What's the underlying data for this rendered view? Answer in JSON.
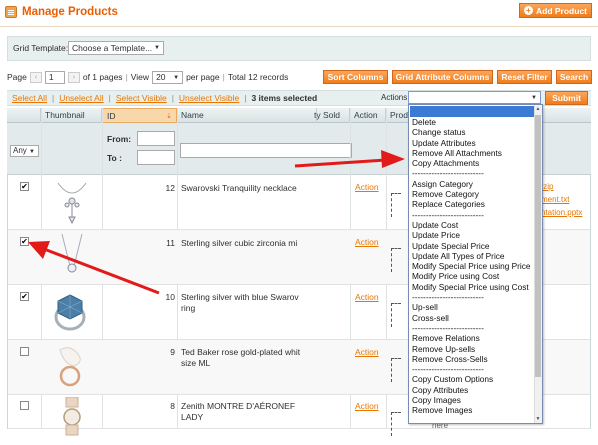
{
  "header": {
    "title": "Manage Products",
    "add_product_label": "Add Product"
  },
  "grid_template": {
    "label": "Grid Template:",
    "selected": "Choose a Template..."
  },
  "pager": {
    "page_label": "Page",
    "page_value": "1",
    "of_pages": "of 1 pages",
    "view_label": "View",
    "per_page_value": "20",
    "per_page_label": "per page",
    "total": "Total 12 records"
  },
  "buttons": {
    "sort_columns": "Sort Columns",
    "grid_attribute_columns": "Grid Attribute Columns",
    "reset_filter": "Reset Filter",
    "search": "Search",
    "submit": "Submit"
  },
  "massaction": {
    "select_all": "Select All",
    "unselect_all": "Unselect All",
    "select_visible": "Select Visible",
    "unselect_visible": "Unselect Visible",
    "selected_count": "3 items selected",
    "actions_label": "Actions"
  },
  "columns": {
    "thumbnail": "Thumbnail",
    "id": "ID",
    "name": "Name",
    "qty_sold": "ty Sold",
    "action": "Action",
    "prod": "Prod"
  },
  "filters": {
    "any": "Any",
    "from": "From:",
    "to": "To :"
  },
  "rows": [
    {
      "checked": true,
      "id": "12",
      "name_lines": [
        "Swarovski Tranquility necklace"
      ],
      "action": "Action"
    },
    {
      "checked": true,
      "id": "11",
      "name_lines": [
        "Sterling silver cubic zirconia mi"
      ],
      "action": "Action"
    },
    {
      "checked": true,
      "id": "10",
      "name_lines": [
        "Sterling silver with blue Swarov",
        "ring"
      ],
      "action": "Action"
    },
    {
      "checked": false,
      "id": "9",
      "name_lines": [
        "Ted Baker rose gold-plated whit",
        "size ML"
      ],
      "action": "Action"
    },
    {
      "checked": false,
      "id": "8",
      "name_lines": [
        "Zenith MONTRE D'AÉRONEF",
        "LADY"
      ],
      "action": "Action"
    }
  ],
  "attachment_links": [
    ".zip",
    "ment.txt",
    "ntation.pptx"
  ],
  "dropdown_items": [
    "",
    "Delete",
    "Change status",
    "Update Attributes",
    "Remove All Attachments",
    "Copy Attachments",
    "--------------------------",
    "Assign Category",
    "Remove Category",
    "Replace Categories",
    "--------------------------",
    "Update Cost",
    "Update Price",
    "Update Special Price",
    "Update All Types of Price",
    "Modify Special Price using Price",
    "Modify Price using Cost",
    "Modify Special Price using Cost",
    "--------------------------",
    "Up-sell",
    "Cross-sell",
    "--------------------------",
    "Remove Relations",
    "Remove Up-sells",
    "Remove Cross-Sells",
    "--------------------------",
    "Copy Custom Options",
    "Copy Attributes",
    "Copy Images",
    "Remove Images"
  ],
  "partial_text": "nere",
  "colors": {
    "accent": "#eb5e00",
    "link": "#ea7601",
    "arrow": "#e21a1a",
    "highlight": "#3b7bd4"
  }
}
